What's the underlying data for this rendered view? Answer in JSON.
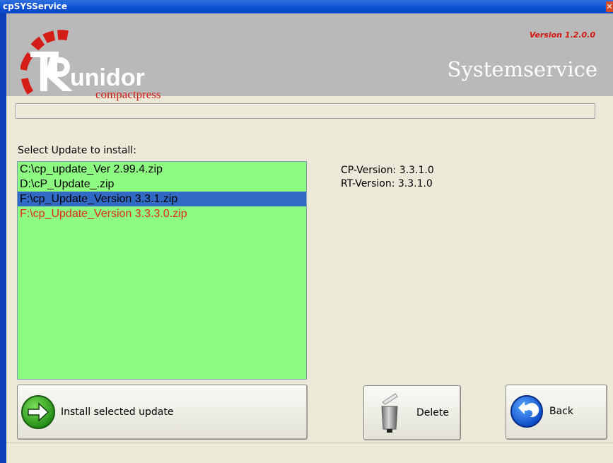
{
  "window": {
    "title": "cpSYSService",
    "close_glyph": "✕"
  },
  "header": {
    "logo_text": "unidor",
    "logo_sub": "compactpress",
    "version": "Version 1.2.0.0",
    "title": "Systemservice"
  },
  "progress": {
    "value": 0
  },
  "list": {
    "label": "Select Update to install:",
    "items": [
      {
        "text": "C:\\cp_update_Ver 2.99.4.zip",
        "state": "normal"
      },
      {
        "text": "D:\\cP_Update_.zip",
        "state": "normal"
      },
      {
        "text": "F:\\cp_Update_Version 3.3.1.zip",
        "state": "selected"
      },
      {
        "text": "F:\\cp_Update_Version 3.3.3.0.zip",
        "state": "red"
      }
    ]
  },
  "info": {
    "cp_version": "CP-Version: 3.3.1.0",
    "rt_version": "RT-Version: 3.3.1.0"
  },
  "buttons": {
    "install": {
      "label": "Install selected update",
      "icon": "arrow-right-icon"
    },
    "delete": {
      "label": "Delete",
      "icon": "trash-can-icon"
    },
    "back": {
      "label": "Back",
      "icon": "back-arrow-icon"
    }
  },
  "colors": {
    "accent_red": "#d3150f",
    "list_bg": "#8dfb82",
    "selected": "#316ac5"
  }
}
